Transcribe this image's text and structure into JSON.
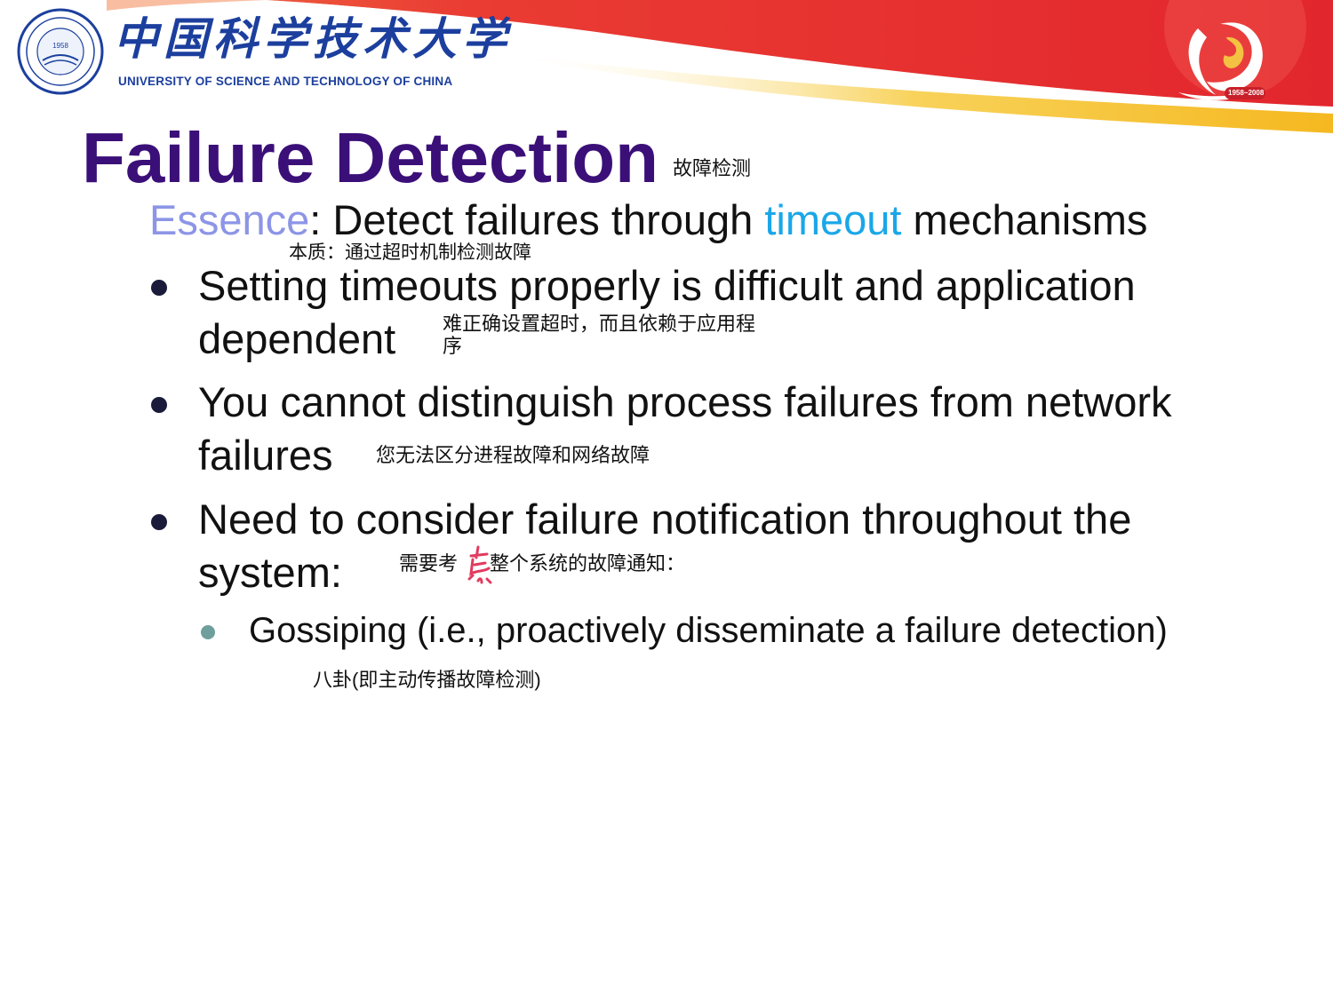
{
  "header": {
    "university_cn": "中国科学技术大学",
    "university_en": "UNIVERSITY OF SCIENCE AND TECHNOLOGY OF CHINA",
    "seal_year": "1958",
    "seal_text": "University of Science and Technology of China",
    "anniversary_years": "1958~2008"
  },
  "slide": {
    "title": "Failure Detection",
    "title_note": "故障检测",
    "essence": {
      "label": "Essence",
      "colon": ":",
      "text_before": " Detect failures through ",
      "highlight": "timeout",
      "text_after": " mechanisms",
      "note": "本质：通过超时机制检测故障"
    },
    "bullets": [
      {
        "line1": "Setting timeouts properly is difficult and application",
        "line2": "dependent",
        "note_line1": "难正确设置超时，而且依赖于应用程",
        "note_line2": "序"
      },
      {
        "line1": "You cannot distinguish process failures from network",
        "line2": "failures",
        "note_line1": "您无法区分进程故障和网络故障"
      },
      {
        "line1": "Need to consider failure notification throughout the",
        "line2": "system:",
        "note_before": "需要考",
        "note_after": "整个系统的故障通知："
      }
    ],
    "sub_bullets": [
      {
        "text": "Gossiping (i.e., proactively disseminate a failure detection)",
        "note": "八卦(即主动传播故障检测)"
      }
    ]
  },
  "colors": {
    "title": "#3b0f78",
    "essence": "#8c95e6",
    "timeout": "#1aa7e8",
    "banner_red": "#e32a2a",
    "banner_yellow": "#f7c948",
    "logo_blue": "#1c3f9e"
  }
}
